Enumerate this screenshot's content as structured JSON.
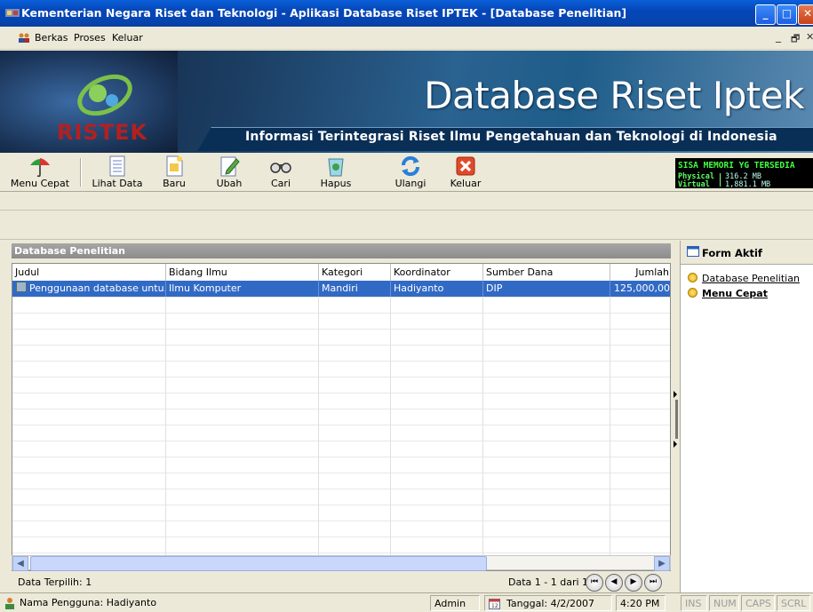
{
  "window": {
    "title": "Kementerian Negara Riset dan Teknologi - Aplikasi Database Riset IPTEK - [Database Penelitian]",
    "controls": [
      "minimize",
      "maximize",
      "close"
    ]
  },
  "menu": [
    "Berkas",
    "Proses",
    "Keluar"
  ],
  "banner": {
    "title": "Database Riset Iptek",
    "subtitle": "Informasi Terintegrasi Riset Ilmu Pengetahuan dan Teknologi di Indonesia",
    "logo_text": "RISTEK"
  },
  "toolbar": [
    {
      "label": "Menu Cepat",
      "icon": "umbrella-icon"
    },
    {
      "label": "Lihat Data",
      "icon": "document-list-icon"
    },
    {
      "label": "Baru",
      "icon": "new-document-icon"
    },
    {
      "label": "Ubah",
      "icon": "edit-document-icon"
    },
    {
      "label": "Cari",
      "icon": "binoculars-icon"
    },
    {
      "label": "Hapus",
      "icon": "recycle-bin-icon"
    },
    {
      "label": "Ulangi",
      "icon": "refresh-icon"
    },
    {
      "label": "Keluar",
      "icon": "exit-icon"
    }
  ],
  "memory": {
    "title": "SISA MEMORI YG TERSEDIA",
    "physical_label": "Physical",
    "physical_value": "316.2 MB",
    "virtual_label": "Virtual",
    "virtual_value": "1,881.1 MB"
  },
  "panel": {
    "title": "Database Penelitian",
    "columns": [
      "Judul",
      "Bidang Ilmu",
      "Kategori",
      "Koordinator",
      "Sumber Dana",
      "Jumlah"
    ],
    "rows": [
      [
        "Penggunaan database untu...",
        "Ilmu Komputer",
        "Mandiri",
        "Hadiyanto",
        "DIP",
        "125,000,00"
      ]
    ],
    "selected_count": "Data Terpilih: 1",
    "paging": "Data 1 - 1 dari 1"
  },
  "right_pane": {
    "title": "Form Aktif",
    "items": [
      "Database Penelitian",
      "Menu Cepat"
    ]
  },
  "status": {
    "user": "Nama Pengguna: Hadiyanto",
    "role": "Admin",
    "date": "Tanggal: 4/2/2007",
    "time": "4:20 PM",
    "keys": [
      "INS",
      "NUM",
      "CAPS",
      "SCRL"
    ]
  }
}
